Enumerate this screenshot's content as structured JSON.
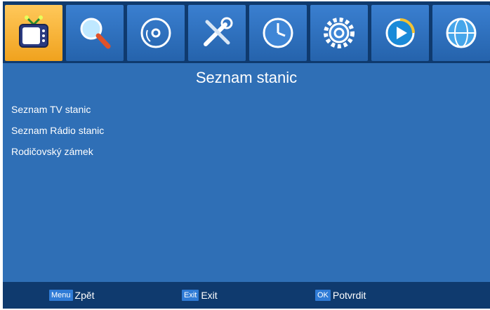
{
  "header": {
    "tabs": [
      {
        "icon": "tv-icon",
        "active": true
      },
      {
        "icon": "search-icon",
        "active": false
      },
      {
        "icon": "disc-icon",
        "active": false
      },
      {
        "icon": "tools-icon",
        "active": false
      },
      {
        "icon": "clock-icon",
        "active": false
      },
      {
        "icon": "gear-icon",
        "active": false
      },
      {
        "icon": "play-icon",
        "active": false
      },
      {
        "icon": "globe-icon",
        "active": false
      }
    ]
  },
  "main": {
    "title": "Seznam stanic",
    "items": [
      {
        "label": "Seznam TV stanic"
      },
      {
        "label": "Seznam Rádio stanic"
      },
      {
        "label": "Rodičovský zámek"
      }
    ]
  },
  "footer": {
    "hints": [
      {
        "key": "Menu",
        "label": "Zpět"
      },
      {
        "key": "Exit",
        "label": "Exit"
      },
      {
        "key": "OK",
        "label": "Potvrdit"
      }
    ]
  },
  "colors": {
    "background": "#2f6fb6",
    "bars": "#0f3a6e",
    "active_tab": "#f7b53a",
    "key_badge": "#2f7bd6"
  }
}
